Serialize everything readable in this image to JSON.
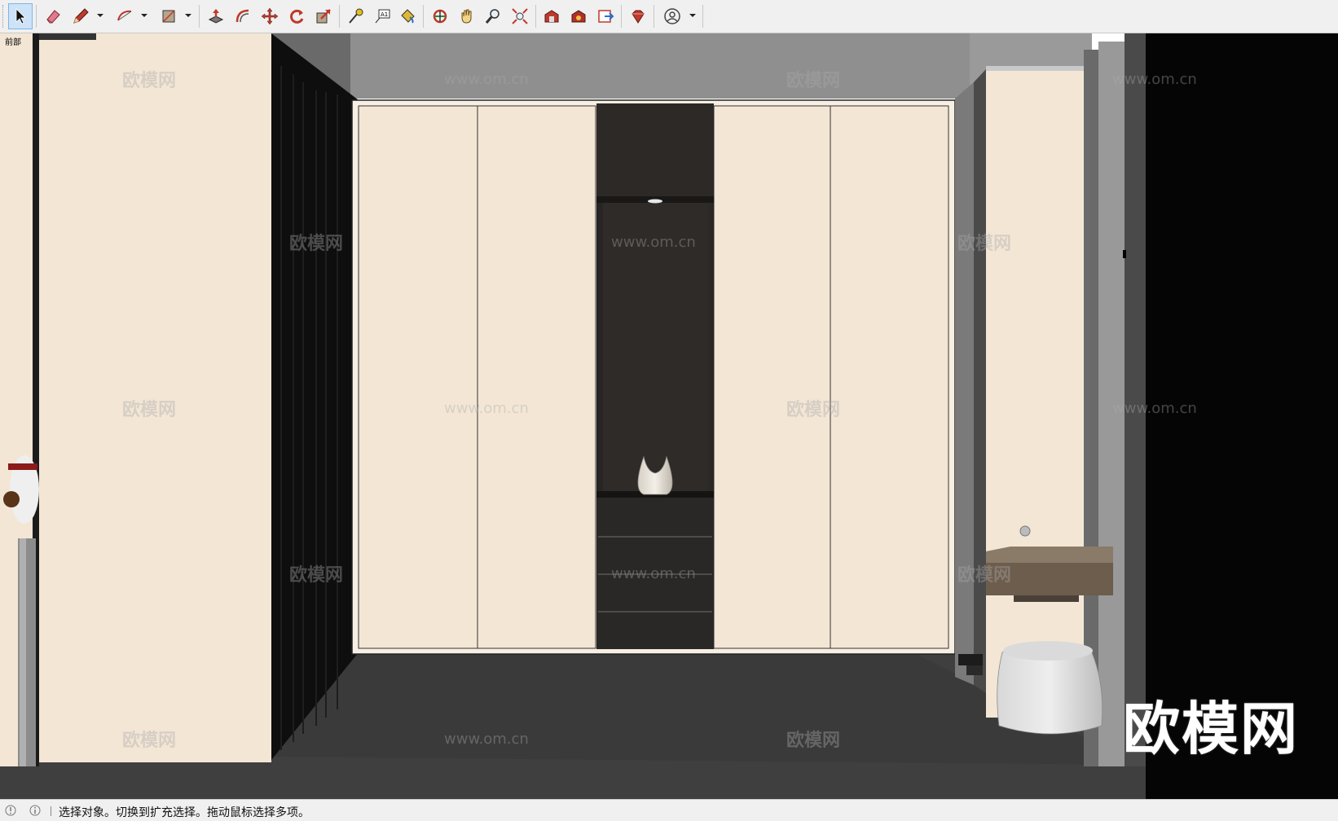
{
  "toolbar": {
    "tools": [
      {
        "name": "select-tool-button",
        "icon": "select-arrow-icon",
        "active": true
      },
      {
        "name": "eraser-tool-button",
        "icon": "eraser-icon"
      },
      {
        "name": "line-tool-button",
        "icon": "pencil-icon",
        "dropdown": true
      },
      {
        "name": "arc-tool-button",
        "icon": "arc-icon",
        "dropdown": true
      },
      {
        "name": "rectangle-tool-button",
        "icon": "rectangle-icon",
        "dropdown": true
      },
      {
        "name": "push-pull-tool-button",
        "icon": "push-pull-icon"
      },
      {
        "name": "offset-tool-button",
        "icon": "offset-icon"
      },
      {
        "name": "move-tool-button",
        "icon": "move-icon"
      },
      {
        "name": "rotate-tool-button",
        "icon": "rotate-icon"
      },
      {
        "name": "scale-tool-button",
        "icon": "scale-icon"
      },
      {
        "name": "tape-measure-tool-button",
        "icon": "tape-measure-icon"
      },
      {
        "name": "text-tool-button",
        "icon": "text-icon"
      },
      {
        "name": "paint-bucket-tool-button",
        "icon": "paint-bucket-icon"
      },
      {
        "name": "orbit-tool-button",
        "icon": "orbit-icon"
      },
      {
        "name": "pan-tool-button",
        "icon": "pan-hand-icon"
      },
      {
        "name": "zoom-tool-button",
        "icon": "zoom-icon"
      },
      {
        "name": "zoom-extents-tool-button",
        "icon": "zoom-extents-icon"
      },
      {
        "name": "3d-warehouse-button",
        "icon": "warehouse-icon"
      },
      {
        "name": "extension-warehouse-button",
        "icon": "extension-icon"
      },
      {
        "name": "layout-send-button",
        "icon": "layout-icon"
      },
      {
        "name": "ruby-console-button",
        "icon": "ruby-icon"
      },
      {
        "name": "account-button",
        "icon": "user-account-icon",
        "dropdown": true
      }
    ]
  },
  "viewport": {
    "scene_label": "前部",
    "watermark_text": "欧模网",
    "watermark_url": "www.om.cn",
    "logo_text": "欧模网"
  },
  "statusbar": {
    "message": "选择对象。切换到扩充选择。拖动鼠标选择多项。"
  },
  "colors": {
    "cream": "#f3e6d5",
    "dark_wood": "#2c2a28",
    "floor": "#3e3e3e",
    "ceiling": "#8d8d8d"
  }
}
